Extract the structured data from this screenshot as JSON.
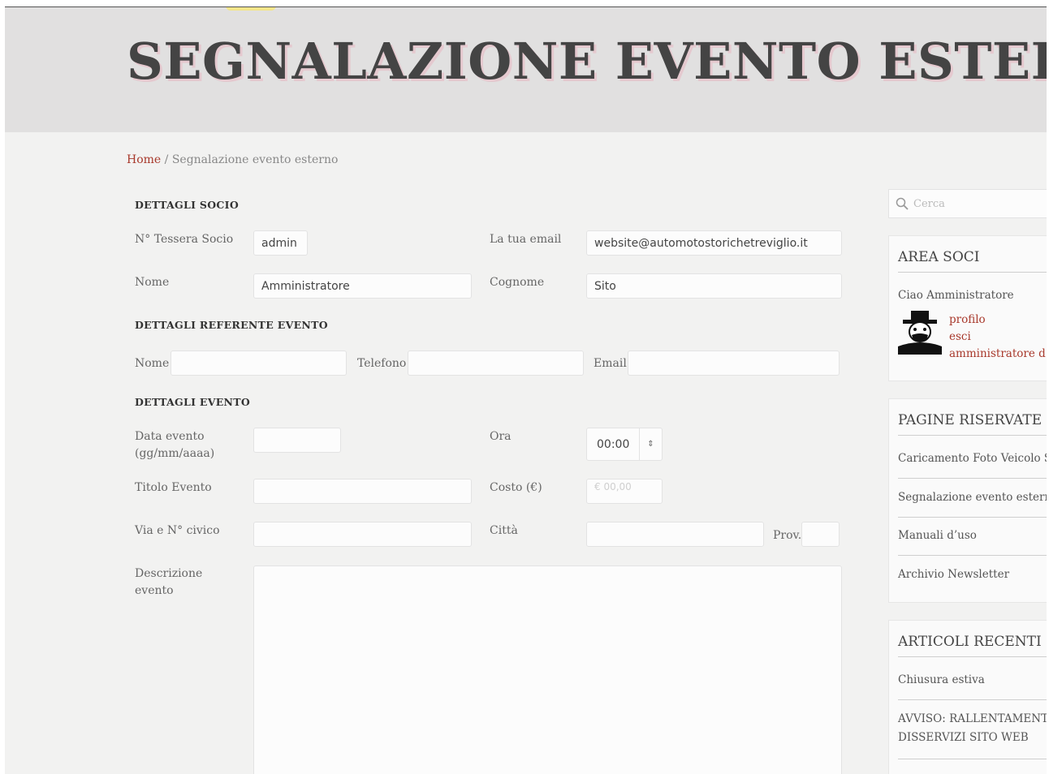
{
  "header": {
    "title": "SEGNALAZIONE EVENTO ESTERNO"
  },
  "breadcrumb": {
    "home": "Home",
    "separator": "/",
    "current": "Segnalazione evento esterno"
  },
  "form": {
    "socio_section": "DETTAGLI SOCIO",
    "tessera_label": "N° Tessera Socio",
    "tessera_value": "admin",
    "email_label": "La tua email",
    "email_value": "website@automotostorichetreviglio.it",
    "nome_label": "Nome",
    "nome_value": "Amministratore",
    "cognome_label": "Cognome",
    "cognome_value": "Sito",
    "referente_section": "DETTAGLI REFERENTE EVENTO",
    "ref_nome_label": "Nome",
    "ref_telefono_label": "Telefono",
    "ref_email_label": "Email",
    "evento_section": "DETTAGLI EVENTO",
    "data_label": "Data evento (gg/mm/aaaa)",
    "ora_label": "Ora",
    "ora_value": "00:00",
    "titolo_label": "Titolo Evento",
    "costo_label": "Costo (€)",
    "costo_placeholder": "€ 00,00",
    "via_label": "Via e N° civico",
    "citta_label": "Città",
    "prov_label": "Prov.",
    "descrizione_label": "Descrizione evento"
  },
  "sidebar": {
    "search_placeholder": "Cerca",
    "area_soci": {
      "title": "AREA SOCI",
      "greeting": "Ciao Amministratore",
      "links": [
        "profilo",
        "esci",
        "amministratore d"
      ]
    },
    "pagine_riservate": {
      "title": "PAGINE RISERVATE",
      "items": [
        "Caricamento Foto Veicolo S",
        "Segnalazione evento estern",
        "Manuali d’uso",
        "Archivio Newsletter"
      ]
    },
    "articoli_recenti": {
      "title": "ARTICOLI RECENTI",
      "items": [
        "Chiusura estiva",
        "AVVISO: RALLENTAMENTI",
        "DISSERVIZI SITO WEB"
      ]
    }
  },
  "colors": {
    "accent_red": "#a8392c",
    "header_bg": "#e1e0e0",
    "page_bg": "#f2f2f1"
  }
}
